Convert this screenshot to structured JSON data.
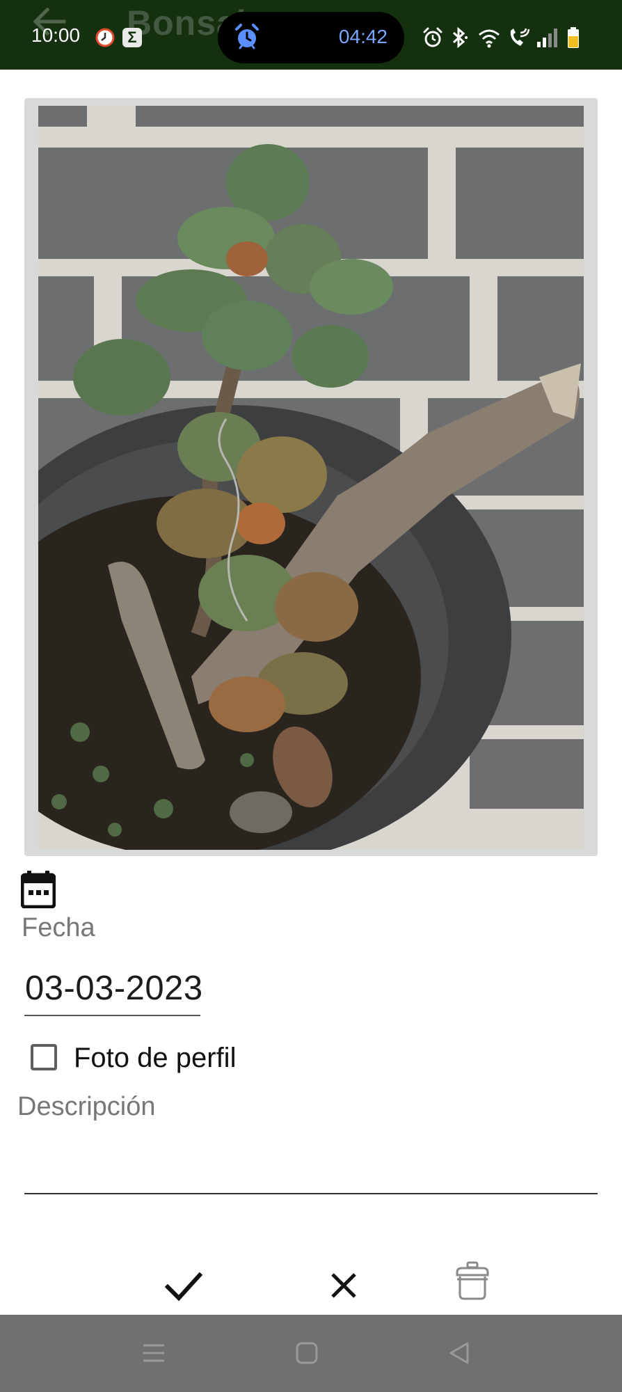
{
  "status_bar": {
    "time": "10:00",
    "alarm_pill_time": "04:42",
    "icons": [
      "clock-notification-icon",
      "sum-app-icon",
      "alarm-icon",
      "bluetooth-icon",
      "wifi-icon",
      "wifi-call-icon",
      "signal-icon",
      "battery-icon"
    ],
    "colors": {
      "background": "#14300f",
      "pill_text": "#7aa7ff",
      "battery": "#f0c020"
    }
  },
  "app_bar": {
    "title": "Bonsai",
    "back_icon": "back-arrow-icon"
  },
  "photo": {
    "subject": "bonsai-tree-in-pot-photo"
  },
  "form": {
    "date_icon": "calendar-icon",
    "date_label": "Fecha",
    "date_value": "03-03-2023",
    "profile_photo_label": "Foto de perfil",
    "profile_photo_checked": false,
    "description_label": "Descripción",
    "description_value": ""
  },
  "actions": {
    "confirm_icon": "check-icon",
    "cancel_icon": "close-icon",
    "delete_icon": "trash-icon"
  },
  "nav_bar": {
    "icons": [
      "menu-icon",
      "home-icon",
      "back-icon"
    ],
    "background": "#707070"
  }
}
